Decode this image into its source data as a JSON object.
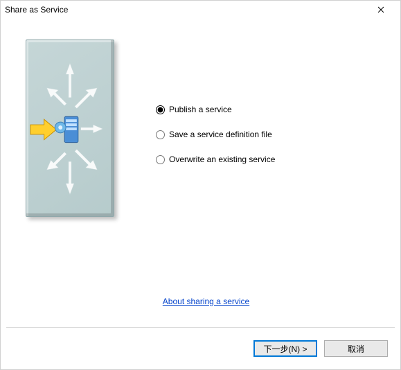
{
  "titlebar": {
    "title": "Share as Service"
  },
  "options": {
    "group": "share_mode",
    "items": [
      {
        "label": "Publish a service",
        "selected": true
      },
      {
        "label": "Save a service definition file",
        "selected": false
      },
      {
        "label": "Overwrite an existing service",
        "selected": false
      }
    ]
  },
  "link": {
    "label": "About sharing a service"
  },
  "footer": {
    "next_label": "下一步(N) >",
    "cancel_label": "取消"
  }
}
